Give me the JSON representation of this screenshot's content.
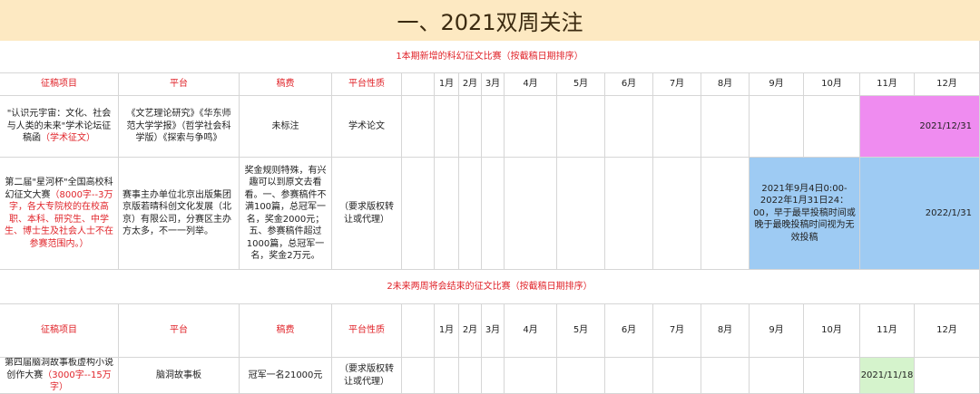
{
  "title": "一、2021双周关注",
  "section1": {
    "label": "1本期新增的科幻征文比赛（按截稿日期排序）"
  },
  "section2": {
    "label": "2未来两周将会结束的征文比赛（按截稿日期排序）"
  },
  "headers": {
    "project": "征稿项目",
    "platform": "平台",
    "fee": "稿费",
    "nature": "平台性质",
    "months": [
      "1月",
      "2月",
      "3月",
      "4月",
      "5月",
      "6月",
      "7月",
      "8月",
      "9月",
      "10月",
      "11月",
      "12月"
    ]
  },
  "rows1": [
    {
      "project": "\"认识元宇宙：文化、社会与人类的未来\"学术论坛征稿函",
      "project_note": "（学术征文）",
      "platform": "《文艺理论研究》《华东师范大学学报》（哲学社会科学版）《探索与争鸣》",
      "fee": "未标注",
      "nature": "学术论文",
      "deadline": "2021/12/31",
      "highlight": "#ef8cf0"
    },
    {
      "project": "第二届\"星河杯\"全国高校科幻征文大赛",
      "project_note": "（8000字--3万字，各大专院校的在校高职、本科、研究生、中学生、博士生及社会人士不在参赛范围内。）",
      "platform": "赛事主办单位北京出版集团京版若晴科创文化发展（北京）有限公司，分赛区主办方太多，不一一列举。",
      "fee": "奖金规则特殊，有兴趣可以到原文去看看。一、参赛稿件不满100篇，总冠军一名，奖金2000元；五、参赛稿件超过1000篇，总冠军一名，奖金2万元。",
      "nature": "（要求版权转让或代理）",
      "period": "2021年9月4日0:00-2022年1月31日24：00，早于最早投稿时间或晚于最晚投稿时间视为无效投稿",
      "deadline": "2022/1/31",
      "highlight": "#9ecbf3"
    }
  ],
  "rows2": [
    {
      "project": "第四届脑洞故事板虚构小说创作大赛",
      "project_note": "（3000字--15万字）",
      "platform": "脑洞故事板",
      "fee": "冠军一名21000元",
      "nature": "（要求版权转让或代理）",
      "deadline": "2021/11/18",
      "highlight": "#d5f3cc"
    }
  ]
}
